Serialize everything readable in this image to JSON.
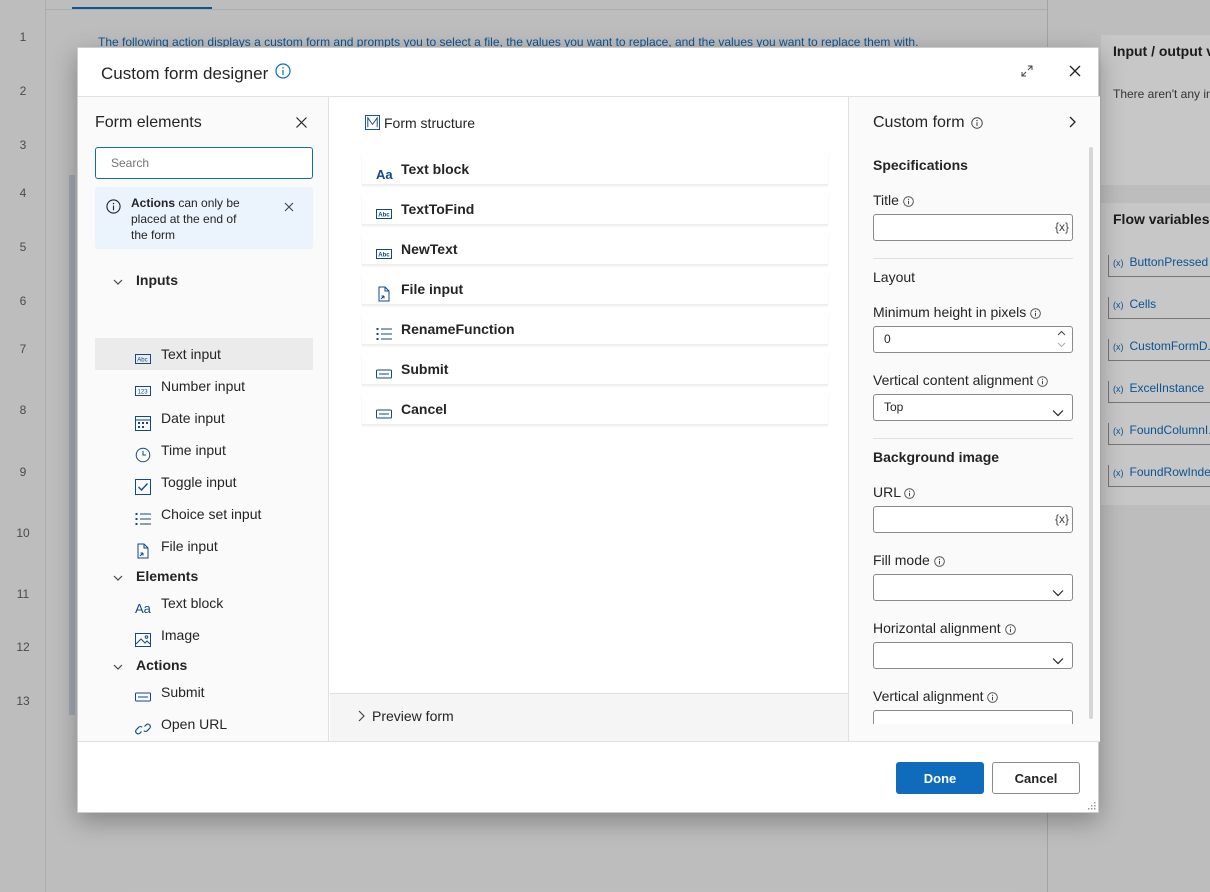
{
  "background": {
    "line_numbers": [
      "1",
      "2",
      "3",
      "4",
      "5",
      "6",
      "7",
      "8",
      "9",
      "10",
      "11",
      "12",
      "13"
    ],
    "description": "The following action displays a custom form and prompts you to select a file, the values you want to replace, and the values you want to replace them with.",
    "right_panel": {
      "io_title": "Input / output v",
      "io_empty": "There aren't any in",
      "vars_title": "Flow variables",
      "variables": [
        "ButtonPressed",
        "Cells",
        "CustomFormD...",
        "ExcelInstance",
        "FoundColumnI...",
        "FoundRowIndex"
      ]
    }
  },
  "dialog": {
    "title": "Custom form designer",
    "left": {
      "title": "Form elements",
      "search_placeholder": "Search",
      "note_bold": "Actions",
      "note_rest": " can only be placed at the end of the form",
      "groups": [
        {
          "label": "Inputs",
          "items": [
            {
              "label": "Text input",
              "icon": "text-input-icon"
            },
            {
              "label": "Number input",
              "icon": "number-input-icon"
            },
            {
              "label": "Date input",
              "icon": "calendar-icon"
            },
            {
              "label": "Time input",
              "icon": "clock-icon"
            },
            {
              "label": "Toggle input",
              "icon": "checkbox-icon"
            },
            {
              "label": "Choice set input",
              "icon": "list-icon"
            },
            {
              "label": "File input",
              "icon": "file-icon"
            }
          ]
        },
        {
          "label": "Elements",
          "items": [
            {
              "label": "Text block",
              "icon": "text-block-icon"
            },
            {
              "label": "Image",
              "icon": "image-icon"
            }
          ]
        },
        {
          "label": "Actions",
          "items": [
            {
              "label": "Submit",
              "icon": "submit-icon"
            },
            {
              "label": "Open URL",
              "icon": "link-icon"
            }
          ]
        }
      ]
    },
    "middle": {
      "title": "Form structure",
      "items": [
        {
          "label": "Text block",
          "icon": "text-block-icon"
        },
        {
          "label": "TextToFind",
          "icon": "text-input-icon"
        },
        {
          "label": "NewText",
          "icon": "text-input-icon"
        },
        {
          "label": "File input",
          "icon": "file-icon"
        },
        {
          "label": "RenameFunction",
          "icon": "list-icon"
        },
        {
          "label": "Submit",
          "icon": "submit-icon"
        },
        {
          "label": "Cancel",
          "icon": "submit-icon"
        }
      ],
      "preview_label": "Preview form"
    },
    "right": {
      "title": "Custom form",
      "specifications": "Specifications",
      "title_label": "Title",
      "title_value": "",
      "fx": "{x}",
      "layout": "Layout",
      "min_height_label": "Minimum height in pixels",
      "min_height_value": "0",
      "vertical_content_label": "Vertical content alignment",
      "vertical_content_value": "Top",
      "background_image": "Background image",
      "url_label": "URL",
      "url_value": "",
      "fill_mode_label": "Fill mode",
      "horizontal_alignment_label": "Horizontal alignment",
      "vertical_alignment_label": "Vertical alignment"
    },
    "buttons": {
      "done": "Done",
      "cancel": "Cancel"
    }
  },
  "colors": {
    "accent": "#0f6cbd",
    "info_bg": "#ebf3fc"
  }
}
